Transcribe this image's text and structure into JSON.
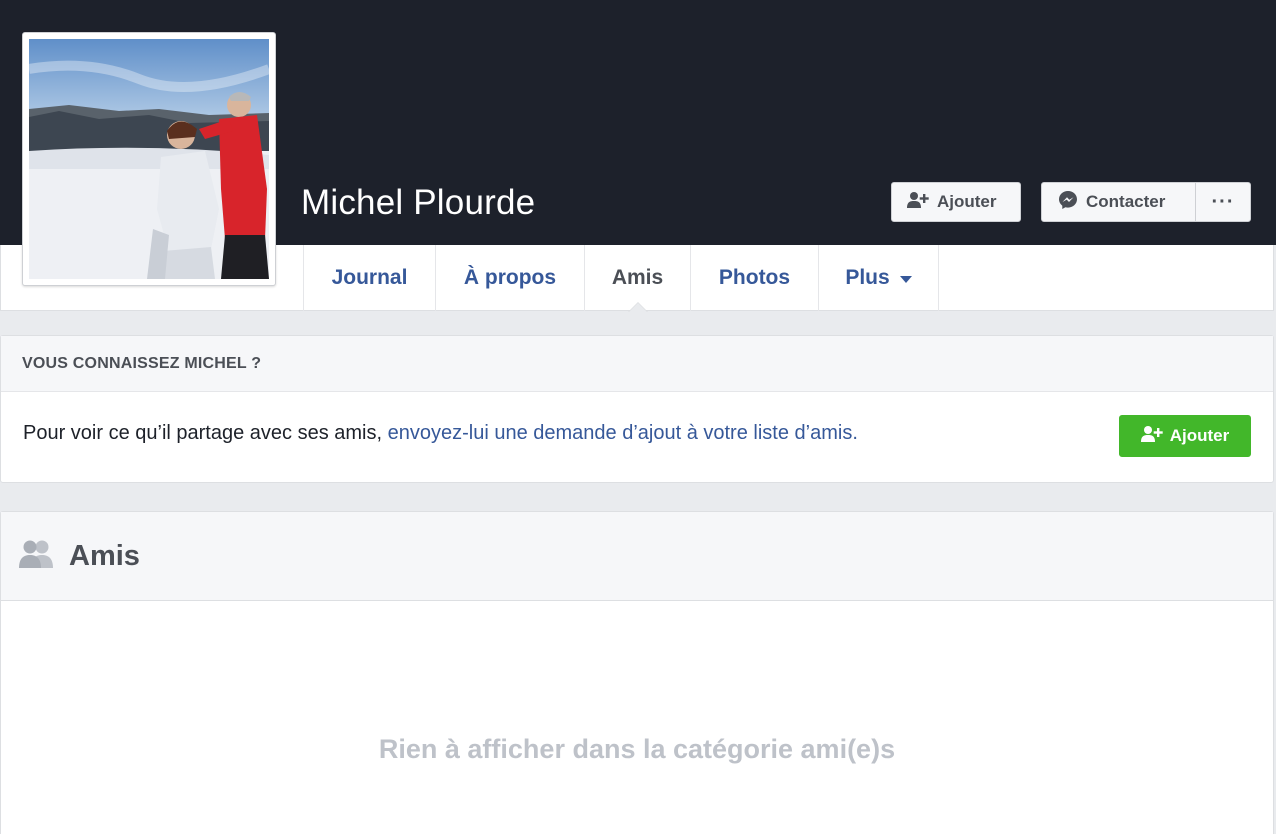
{
  "profile": {
    "name": "Michel Plourde"
  },
  "header_actions": {
    "add_label": "Ajouter",
    "contact_label": "Contacter",
    "more_label": "···"
  },
  "nav": {
    "tabs": [
      {
        "label": "Journal",
        "active": false
      },
      {
        "label": "À propos",
        "active": false
      },
      {
        "label": "Amis",
        "active": true
      },
      {
        "label": "Photos",
        "active": false
      },
      {
        "label": "Plus",
        "active": false
      }
    ]
  },
  "know_card": {
    "title": "VOUS CONNAISSEZ MICHEL ?",
    "text": "Pour voir ce qu’il partage avec ses amis, ",
    "link": "envoyez-lui une demande d’ajout à votre liste d’amis.",
    "button_label": "Ajouter"
  },
  "friends_card": {
    "title": "Amis",
    "empty_message": "Rien à afficher dans la catégorie ami(e)s"
  },
  "colors": {
    "cover": "#1d212b",
    "link": "#365899",
    "green": "#42b72a"
  },
  "icons": {
    "add_friend": "add-friend-icon",
    "messenger": "messenger-icon",
    "friends": "friends-icon"
  }
}
